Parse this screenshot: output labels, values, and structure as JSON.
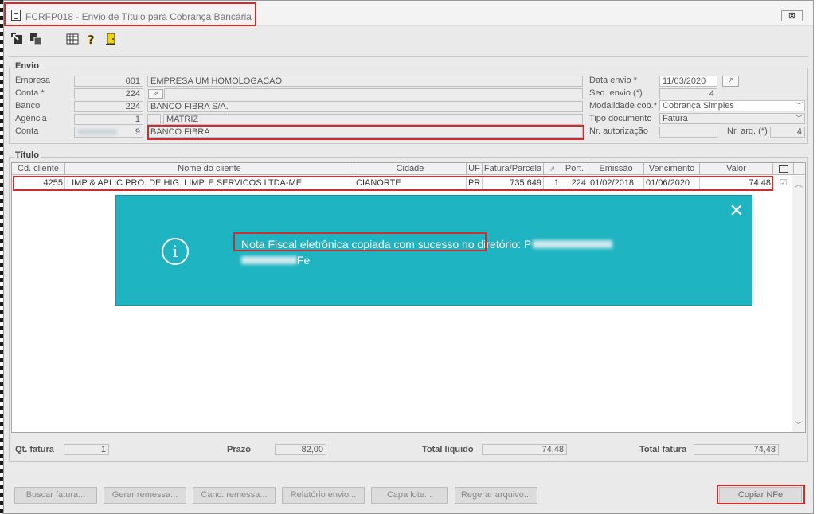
{
  "window": {
    "title": "FCRFP018 - Envio de Título para Cobrança Bancária",
    "close_label": "⊠"
  },
  "toolbar": {
    "icons": [
      "export-icon",
      "copy-icon",
      "calendar-icon",
      "help-icon",
      "exit-door-icon"
    ]
  },
  "envio": {
    "legend": "Envio",
    "empresa": {
      "label": "Empresa",
      "code": "001",
      "name": "EMPRESA UM  HOMOLOGACAO"
    },
    "conta_req": {
      "label": "Conta *",
      "code": "224"
    },
    "banco": {
      "label": "Banco",
      "code": "224",
      "name": "BANCO FIBRA S/A."
    },
    "agencia": {
      "label": "Agência",
      "code": "1",
      "name": "MATRIZ"
    },
    "conta": {
      "label": "Conta",
      "code": "9",
      "name": "BANCO FIBRA"
    },
    "data_envio": {
      "label": "Data envio *",
      "value": "11/03/2020"
    },
    "seq_envio": {
      "label": "Seq. envio (*)",
      "value": "4"
    },
    "modalidade": {
      "label": "Modalidade cob.*",
      "value": "Cobrança Simples"
    },
    "tipo_documento": {
      "label": "Tipo documento",
      "value": "Fatura"
    },
    "nr_autorizacao": {
      "label": "Nr. autorização",
      "value": ""
    },
    "nr_arq": {
      "label": "Nr. arq. (*)",
      "value": "4"
    }
  },
  "titulo": {
    "legend": "Título",
    "columns": [
      "Cd. cliente",
      "Nome do cliente",
      "Cidade",
      "UF",
      "Fatura/Parcela",
      "",
      "Port.",
      "Emissão",
      "Vencimento",
      "Valor"
    ],
    "rows": [
      {
        "cd": "4255",
        "nome": "LIMP & APLIC PRO. DE HIG. LIMP. E SERVICOS LTDA-ME",
        "cidade": "CIANORTE",
        "uf": "PR",
        "fatura": "735.649",
        "parcela": "1",
        "port": "224",
        "emissao": "01/02/2018",
        "vencimento": "01/06/2020",
        "valor": "74,48"
      }
    ]
  },
  "toast": {
    "message_prefix": "Nota Fiscal eletrônica copiada com sucesso",
    "message_mid": " no diretório: P",
    "message_tail": "Fe"
  },
  "footer": {
    "qt_fatura": {
      "label": "Qt. fatura",
      "value": "1"
    },
    "prazo": {
      "label": "Prazo",
      "value": "82,00"
    },
    "total_liquido": {
      "label": "Total líquido",
      "value": "74,48"
    },
    "total_fatura": {
      "label": "Total fatura",
      "value": "74,48"
    }
  },
  "buttons": {
    "buscar": "Buscar fatura...",
    "gerar": "Gerar remessa...",
    "canc": "Canc. remessa...",
    "relatorio": "Relatório envio...",
    "capa": "Capa lote...",
    "regerar": "Regerar arquivo...",
    "copiar": "Copiar NFe"
  },
  "colors": {
    "toast_bg": "#1fb4c1",
    "highlight": "#d42a2a"
  }
}
